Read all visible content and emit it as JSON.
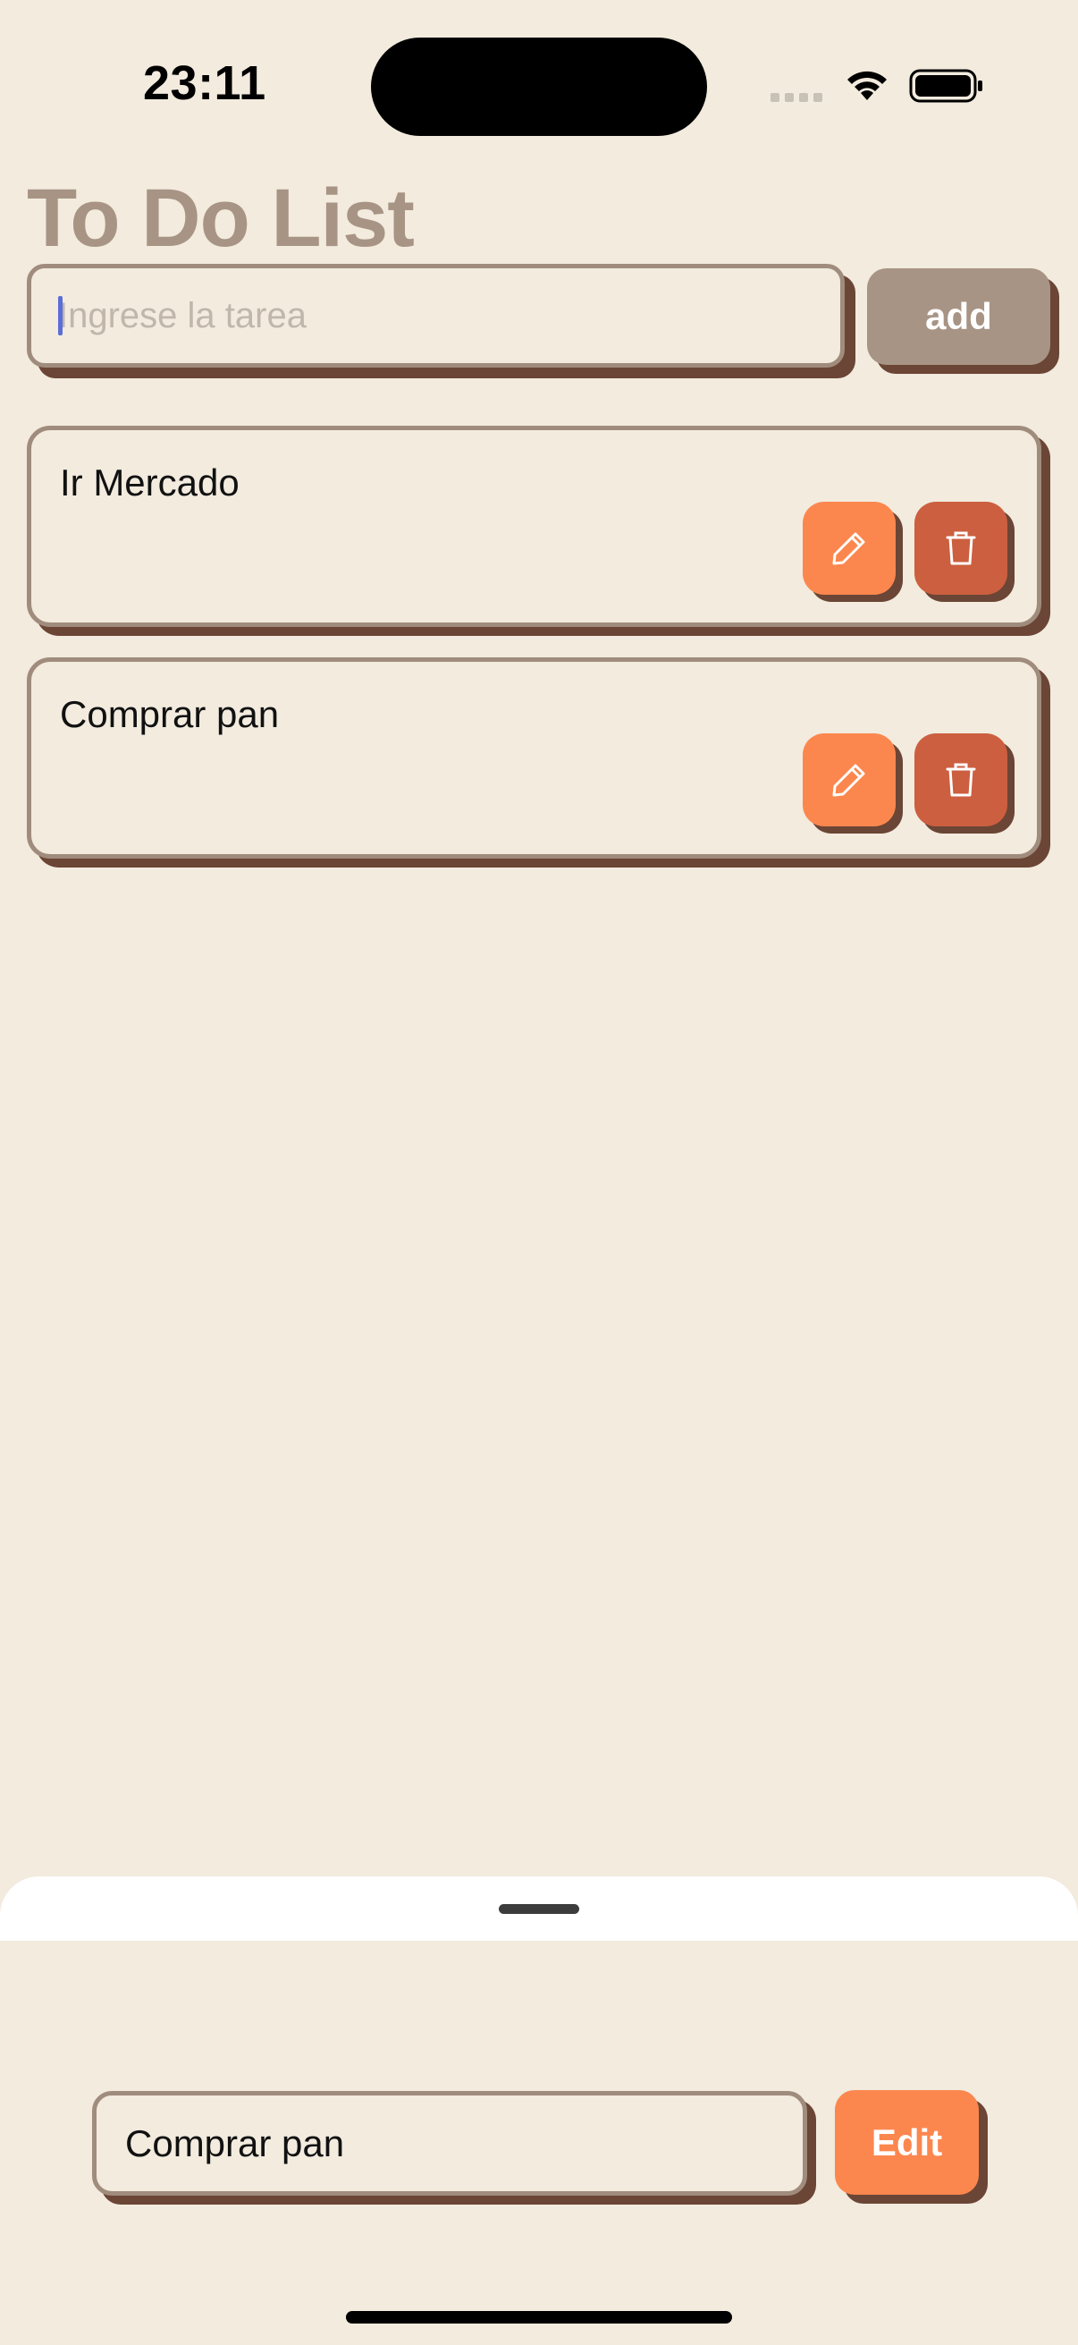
{
  "status_bar": {
    "time": "23:11"
  },
  "header": {
    "title": "To Do List"
  },
  "new_task": {
    "value": "",
    "placeholder": "Ingrese la tarea",
    "add_label": "add"
  },
  "tasks": [
    {
      "text": "Ir Mercado",
      "edit_icon": "pencil-icon",
      "delete_icon": "trash-icon"
    },
    {
      "text": "Comprar pan",
      "edit_icon": "pencil-icon",
      "delete_icon": "trash-icon"
    }
  ],
  "edit_sheet": {
    "value": "Comprar pan",
    "edit_label": "Edit"
  },
  "colors": {
    "background": "#f2ebde",
    "title": "#a89485",
    "border": "#a08c7d",
    "shadow": "#6b4535",
    "edit_orange": "#fc874e",
    "delete_red": "#cc5f3f"
  }
}
